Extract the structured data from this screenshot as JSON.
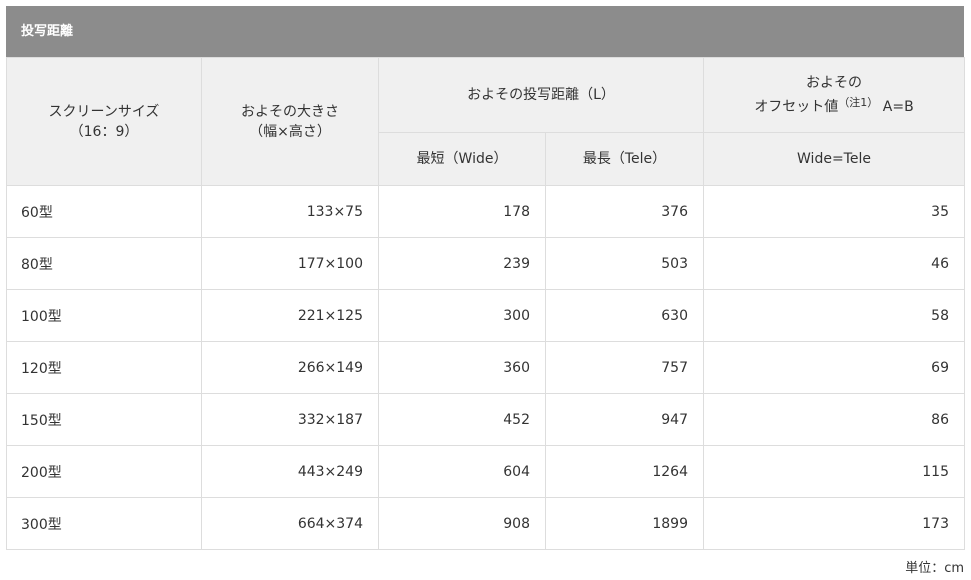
{
  "title": "投写距離",
  "header": {
    "screen_size_line1": "スクリーンサイズ",
    "screen_size_line2": "（16：9）",
    "approx_size_line1": "およその大きさ",
    "approx_size_line2": "（幅×高さ）",
    "throw_distance": "およその投写距離（L）",
    "offset_line1": "およその",
    "offset_line2": "オフセット値",
    "offset_note": "（注1）",
    "offset_ab": "A=B",
    "shortest": "最短（Wide）",
    "longest": "最長（Tele）",
    "wide_tele": "Wide=Tele"
  },
  "rows": [
    {
      "size": "60型",
      "dims": "133×75",
      "shortest": "178",
      "longest": "376",
      "offset": "35"
    },
    {
      "size": "80型",
      "dims": "177×100",
      "shortest": "239",
      "longest": "503",
      "offset": "46"
    },
    {
      "size": "100型",
      "dims": "221×125",
      "shortest": "300",
      "longest": "630",
      "offset": "58"
    },
    {
      "size": "120型",
      "dims": "266×149",
      "shortest": "360",
      "longest": "757",
      "offset": "69"
    },
    {
      "size": "150型",
      "dims": "332×187",
      "shortest": "452",
      "longest": "947",
      "offset": "86"
    },
    {
      "size": "200型",
      "dims": "443×249",
      "shortest": "604",
      "longest": "1264",
      "offset": "115"
    },
    {
      "size": "300型",
      "dims": "664×374",
      "shortest": "908",
      "longest": "1899",
      "offset": "173"
    }
  ],
  "unit": "単位：cm"
}
